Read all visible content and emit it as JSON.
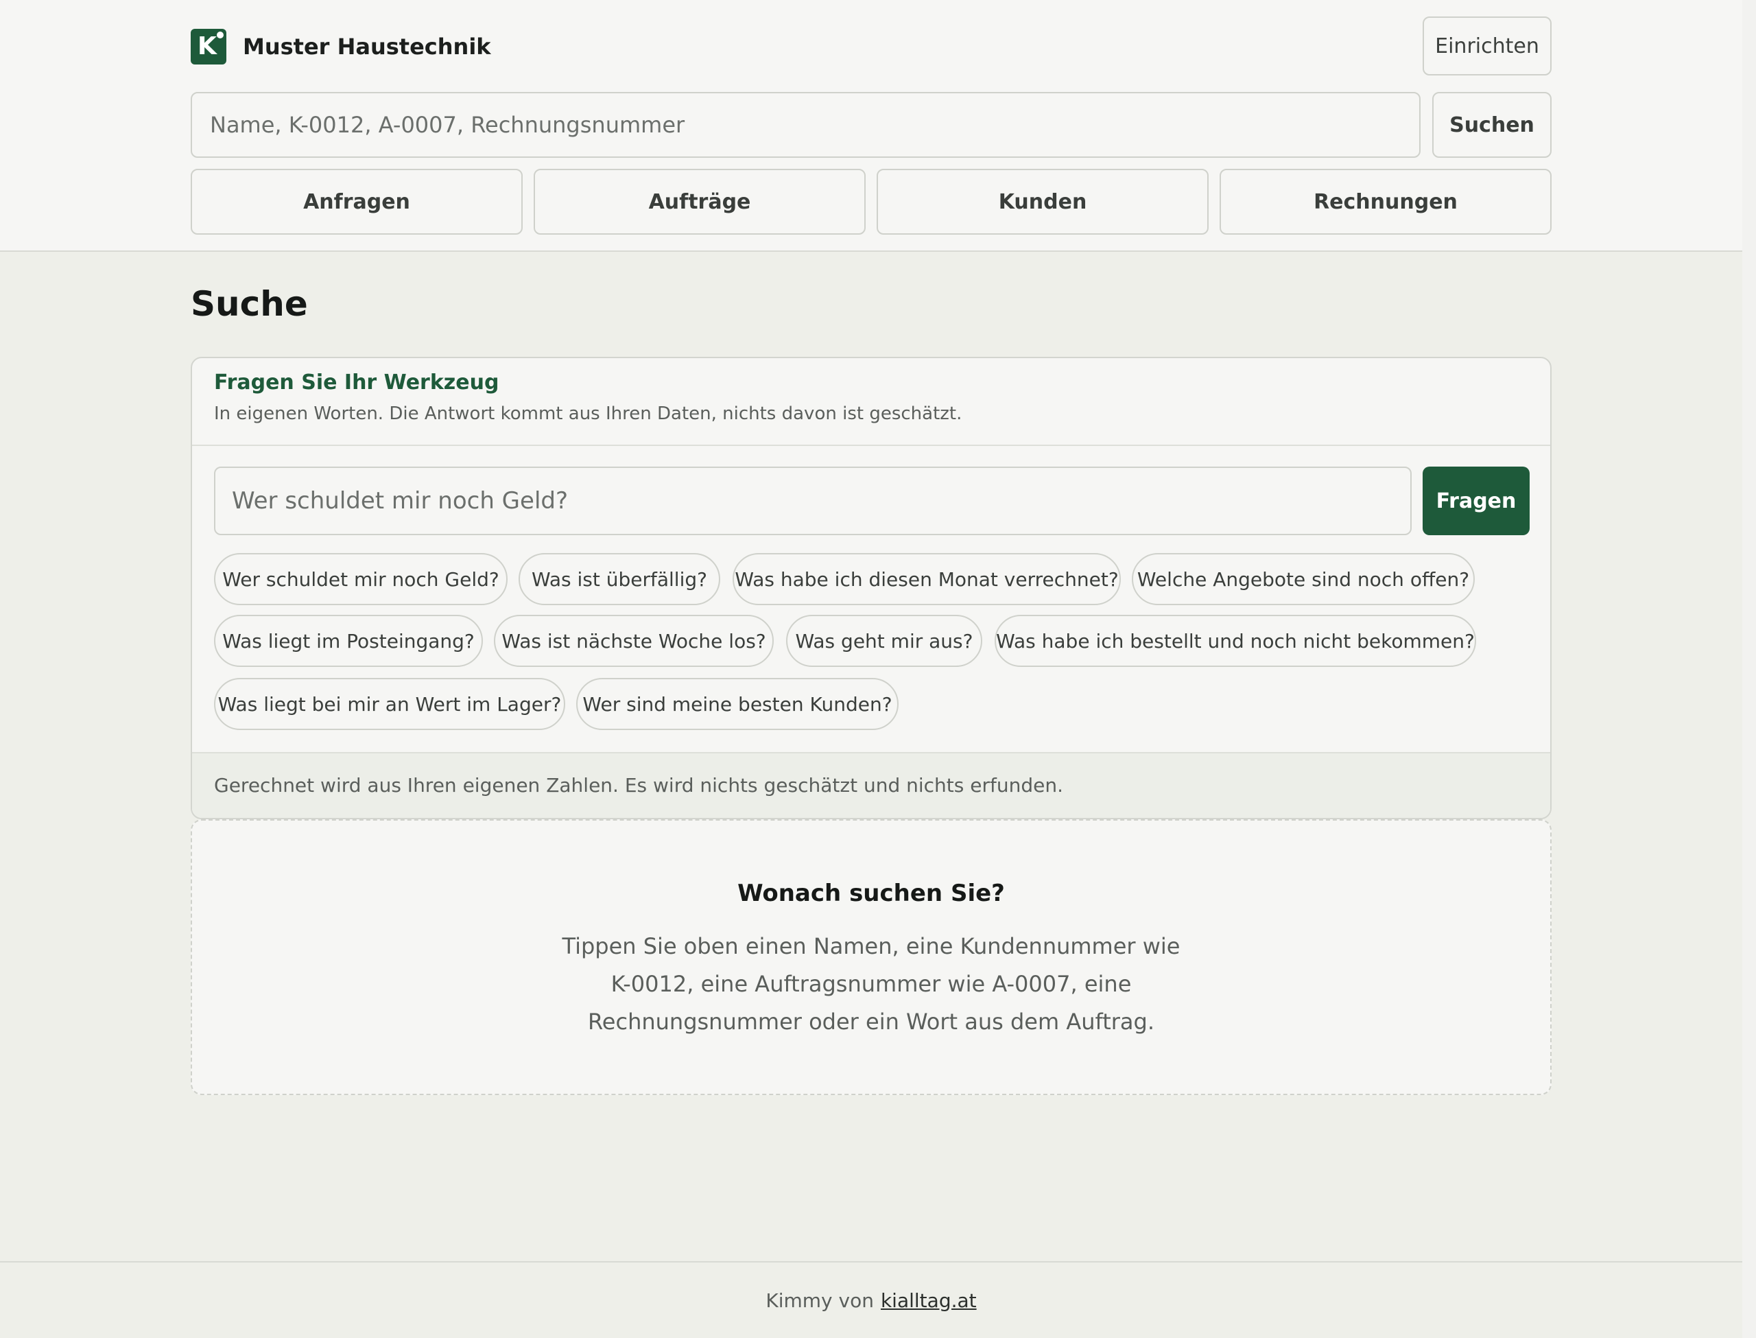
{
  "header": {
    "brand_name": "Muster Haustechnik",
    "brand_logo_icon": "k-logo-icon",
    "setup_label": "Einrichten",
    "search_placeholder": "Name, K-0012, A-0007, Rechnungsnummer",
    "search_button": "Suchen",
    "nav": [
      {
        "label": "Anfragen"
      },
      {
        "label": "Aufträge"
      },
      {
        "label": "Kunden"
      },
      {
        "label": "Rechnungen"
      }
    ]
  },
  "page": {
    "title": "Suche"
  },
  "ask_card": {
    "title": "Fragen Sie Ihr Werkzeug",
    "subtitle": "In eigenen Worten. Die Antwort kommt aus Ihren Daten, nichts davon ist geschätzt.",
    "input_placeholder": "Wer schuldet mir noch Geld?",
    "ask_button": "Fragen",
    "suggestions": [
      {
        "label": "Wer schuldet mir noch Geld?"
      },
      {
        "label": "Was ist überfällig?"
      },
      {
        "label": "Was habe ich diesen Monat verrechnet?"
      },
      {
        "label": "Welche Angebote sind noch offen?"
      },
      {
        "label": "Was liegt im Posteingang?"
      },
      {
        "label": "Was ist nächste Woche los?"
      },
      {
        "label": "Was geht mir aus?"
      },
      {
        "label": "Was habe ich bestellt und noch nicht bekommen?"
      },
      {
        "label": "Was liegt bei mir an Wert im Lager?"
      },
      {
        "label": "Wer sind meine besten Kunden?"
      }
    ],
    "footer_note": "Gerechnet wird aus Ihren eigenen Zahlen. Es wird nichts geschätzt und nichts erfunden."
  },
  "empty_state": {
    "title": "Wonach suchen Sie?",
    "line1": "Tippen Sie oben einen Namen, eine Kundennummer wie",
    "line2": "K-0012, eine Auftragsnummer wie A-0007, eine",
    "line3": "Rechnungsnummer oder ein Wort aus dem Auftrag."
  },
  "footer": {
    "prefix": "Kimmy von",
    "link": "kialltag.at"
  },
  "colors": {
    "accent": "#1e5a3a",
    "background": "#eeefe9",
    "surface": "#f6f6f4"
  }
}
